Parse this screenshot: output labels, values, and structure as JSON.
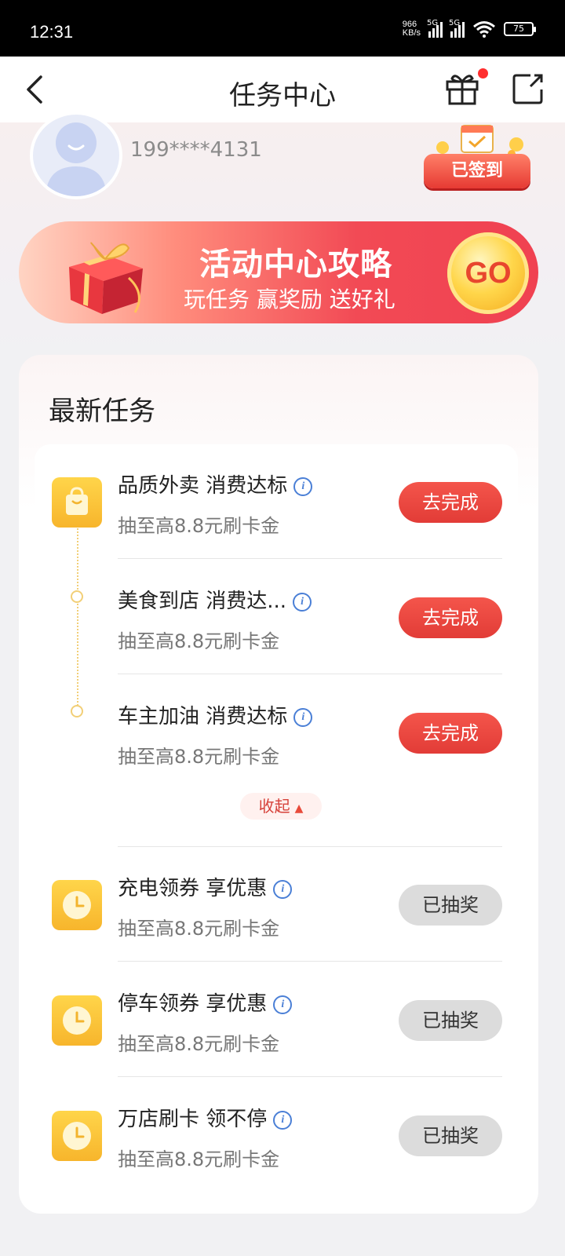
{
  "status_bar": {
    "time": "12:31",
    "net_speed_value": "966",
    "net_speed_unit": "KB/s",
    "sim1": "5G",
    "sim2": "5G",
    "battery": "75"
  },
  "nav": {
    "title": "任务中心"
  },
  "profile": {
    "phone": "199****4131",
    "signin_status": "已签到"
  },
  "banner": {
    "title": "活动中心攻略",
    "subtitle": "玩任务 赢奖励 送好礼",
    "go_label": "GO"
  },
  "tasks_section": {
    "title": "最新任务",
    "collapse_label": "收起",
    "tasks": [
      {
        "title": "品质外卖 消费达标",
        "reward": "抽至高8.8元刷卡金",
        "button": "去完成",
        "state": "go"
      },
      {
        "title": "美食到店 消费达...",
        "reward": "抽至高8.8元刷卡金",
        "button": "去完成",
        "state": "go"
      },
      {
        "title": "车主加油 消费达标",
        "reward": "抽至高8.8元刷卡金",
        "button": "去完成",
        "state": "go"
      },
      {
        "title": "充电领券 享优惠",
        "reward": "抽至高8.8元刷卡金",
        "button": "已抽奖",
        "state": "done"
      },
      {
        "title": "停车领券 享优惠",
        "reward": "抽至高8.8元刷卡金",
        "button": "已抽奖",
        "state": "done"
      },
      {
        "title": "万店刷卡 领不停",
        "reward": "抽至高8.8元刷卡金",
        "button": "已抽奖",
        "state": "done"
      }
    ]
  },
  "colors": {
    "accent_red": "#e23c37",
    "task_icon_yellow": "#f7b52c",
    "done_gray": "#dcdcdc"
  }
}
